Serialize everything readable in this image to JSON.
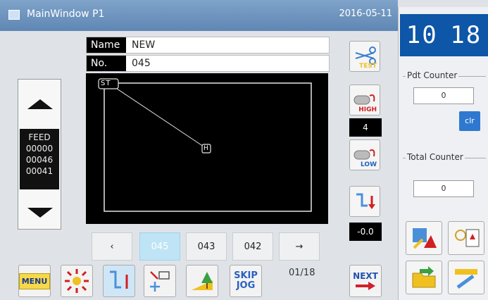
{
  "titlebar": {
    "title": "MainWindow P1",
    "date": "2016-05-11"
  },
  "form": {
    "name_label": "Name",
    "name_value": "NEW",
    "no_label": "No.",
    "no_value": "045"
  },
  "canvas": {
    "start_marker": "ST",
    "end_marker": "H"
  },
  "feed": {
    "label": "FEED",
    "values": [
      "00000",
      "00046",
      "00041"
    ]
  },
  "tension": {
    "test_label": "TEST",
    "high_label": "HIGH",
    "value": "4",
    "low_label": "LOW",
    "offset_value": "-0.0"
  },
  "pager": {
    "prev": "‹",
    "items": [
      "045",
      "043",
      "042"
    ],
    "next": "→",
    "page_indicator": "01/18"
  },
  "toolbar": {
    "menu_label": "MENU",
    "skip_label": "SKIP",
    "jog_label": "JOG",
    "next_label": "NEXT"
  },
  "sidebar": {
    "digital_left": "10",
    "digital_right": "18",
    "pdt_counter_label": "Pdt Counter",
    "pdt_counter_value": "0",
    "clear_label": "clr",
    "total_counter_label": "Total Counter",
    "total_counter_value": "0"
  },
  "colors": {
    "titlebar": "#6a90bb",
    "digital": "#0d56a8",
    "active_page": "#bfe4f6",
    "next_red": "#d0202a",
    "next_blue": "#2050b0"
  }
}
